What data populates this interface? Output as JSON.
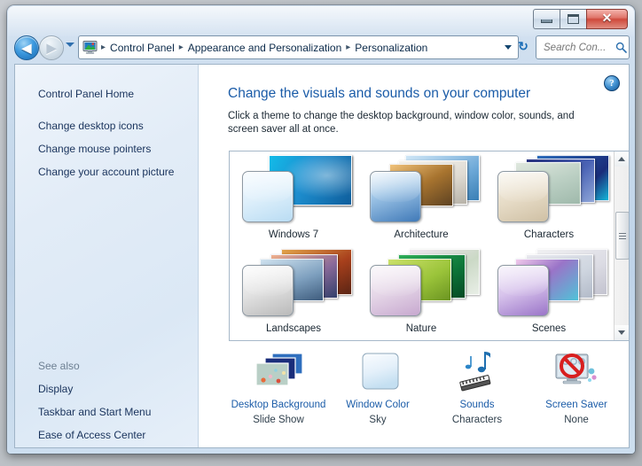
{
  "window": {
    "controls": {
      "minimize": "–",
      "maximize": "□",
      "close": "✕"
    }
  },
  "nav": {
    "back_icon": "◀",
    "forward_icon": "▶",
    "refresh_icon": "↻",
    "breadcrumbs": [
      "Control Panel",
      "Appearance and Personalization",
      "Personalization"
    ],
    "separator": "▸",
    "search": {
      "placeholder": "Search Con...",
      "value": "",
      "icon": "🔍"
    }
  },
  "sidebar": {
    "home": "Control Panel Home",
    "items": [
      "Change desktop icons",
      "Change mouse pointers",
      "Change your account picture"
    ],
    "see_also_label": "See also",
    "see_also_items": [
      "Display",
      "Taskbar and Start Menu",
      "Ease of Access Center"
    ]
  },
  "content": {
    "help_glyph": "?",
    "title": "Change the visuals and sounds on your computer",
    "description": "Click a theme to change the desktop background, window color, sounds, and screen saver all at once.",
    "themes": [
      {
        "name": "Windows 7",
        "tile": "#dff0fb",
        "tile2": "#9cc9ea",
        "c1": "#1d8fd0",
        "c2": "#0f5e9c",
        "c3": "#13a5d8"
      },
      {
        "name": "Architecture",
        "tile": "#cfe3f4",
        "tile2": "#5e92c4",
        "c1": "#8a6a3e",
        "c2": "#c79a5a",
        "c3": "#e8e4dc"
      },
      {
        "name": "Characters",
        "tile": "#ebe4d6",
        "tile2": "#cfc4ae",
        "c1": "#8fb8c4",
        "c2": "#1a2d7a",
        "c3": "#2f6fbe"
      },
      {
        "name": "Landscapes",
        "tile": "#e9e9e9",
        "tile2": "#b9b9b9",
        "c1": "#8c3a20",
        "c2": "#5f6f96",
        "c3": "#cf6a2a"
      },
      {
        "name": "Nature",
        "tile": "#efe2f0",
        "tile2": "#c9a7cf",
        "c1": "#9bc43a",
        "c2": "#128044",
        "c3": "#dfeadf"
      },
      {
        "name": "Scenes",
        "tile": "#e6d9f2",
        "tile2": "#9a74c8",
        "c1": "#b76ad0",
        "c2": "#e8e8ee",
        "c3": "#7ad6e0"
      }
    ],
    "scrollbar": {
      "up": "▲",
      "down": "▼"
    },
    "settings": [
      {
        "title": "Desktop Background",
        "value": "Slide Show",
        "icon": "desktop-background-icon"
      },
      {
        "title": "Window Color",
        "value": "Sky",
        "icon": "window-color-icon"
      },
      {
        "title": "Sounds",
        "value": "Characters",
        "icon": "sounds-icon"
      },
      {
        "title": "Screen Saver",
        "value": "None",
        "icon": "screen-saver-icon"
      }
    ]
  }
}
